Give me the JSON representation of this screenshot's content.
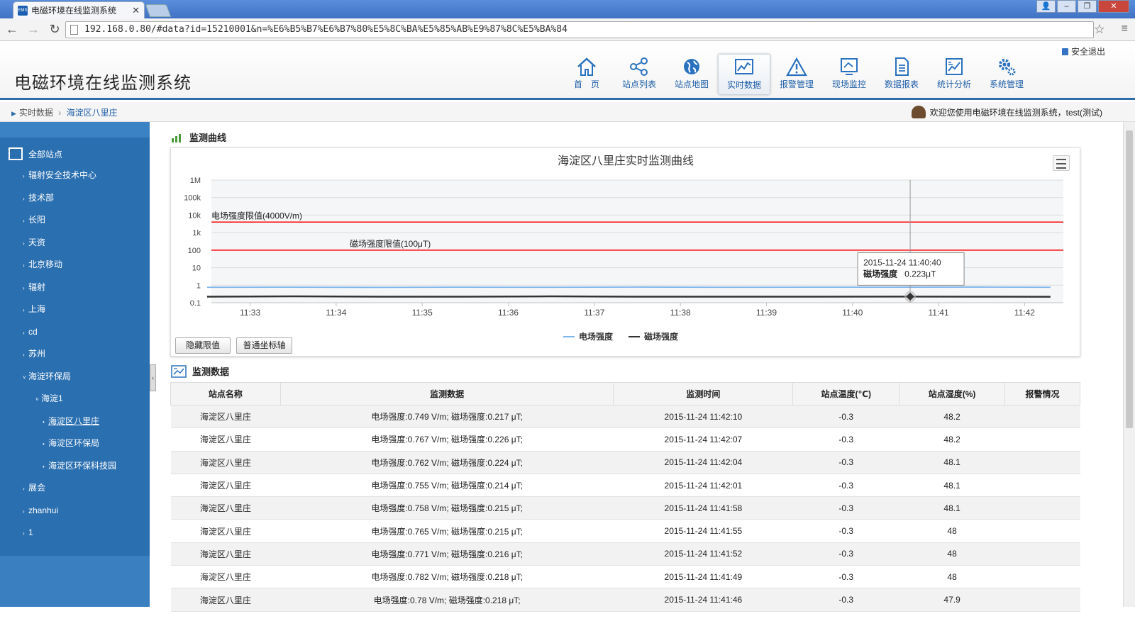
{
  "browser": {
    "tab_title": "电磁环境在线监测系统",
    "tab_favicon": "EMS",
    "url": "192.168.0.80/#data?id=15210001&n=%E6%B5%B7%E6%B7%80%E5%8C%BA%E5%85%AB%E9%87%8C%E5%BA%84"
  },
  "header": {
    "logo": "电磁环境在线监测系统",
    "logout": "安全退出",
    "nav": [
      {
        "label": "首　页",
        "icon": "home-icon"
      },
      {
        "label": "站点列表",
        "icon": "share-icon"
      },
      {
        "label": "站点地图",
        "icon": "globe-icon"
      },
      {
        "label": "实时数据",
        "icon": "realtime-chart-icon"
      },
      {
        "label": "报警管理",
        "icon": "warning-icon"
      },
      {
        "label": "现场监控",
        "icon": "monitor-icon"
      },
      {
        "label": "数据报表",
        "icon": "report-icon"
      },
      {
        "label": "统计分析",
        "icon": "stats-icon"
      },
      {
        "label": "系统管理",
        "icon": "gears-icon"
      }
    ],
    "active_nav": "实时数据"
  },
  "breadcrumb": {
    "parent": "实时数据",
    "current": "海淀区八里庄"
  },
  "welcome": "欢迎您使用电磁环境在线监测系统，test(测试)",
  "sidebar": {
    "root": "全部站点",
    "items": [
      {
        "label": "辐射安全技术中心",
        "level": 1,
        "arrow": "›"
      },
      {
        "label": "技术部",
        "level": 1,
        "arrow": "›"
      },
      {
        "label": "长阳",
        "level": 1,
        "arrow": "›"
      },
      {
        "label": "天资",
        "level": 1,
        "arrow": "›"
      },
      {
        "label": "北京移动",
        "level": 1,
        "arrow": "›"
      },
      {
        "label": "辐射",
        "level": 1,
        "arrow": "›"
      },
      {
        "label": "上海",
        "level": 1,
        "arrow": "›"
      },
      {
        "label": "cd",
        "level": 1,
        "arrow": "›"
      },
      {
        "label": "苏州",
        "level": 1,
        "arrow": "›"
      },
      {
        "label": "海淀环保局",
        "level": 1,
        "arrow": "˅"
      },
      {
        "label": "海淀1",
        "level": 2,
        "arrow": "˅"
      },
      {
        "label": "海淀区八里庄",
        "level": 3,
        "arrow": "•",
        "selected": true
      },
      {
        "label": "海淀区环保局",
        "level": 3,
        "arrow": "•"
      },
      {
        "label": "海淀区环保科技园",
        "level": 3,
        "arrow": "•"
      },
      {
        "label": "展会",
        "level": 1,
        "arrow": "›"
      },
      {
        "label": "zhanhui",
        "level": 1,
        "arrow": "›"
      },
      {
        "label": "1",
        "level": 1,
        "arrow": "›"
      }
    ]
  },
  "chart_section": {
    "title": "监测曲线",
    "hide_limit_button": "隐藏限值",
    "axis_button": "普通坐标轴"
  },
  "chart_data": {
    "type": "line",
    "title": "海淀区八里庄实时监测曲线",
    "y_scale": "log",
    "ylim": [
      0.1,
      1000000
    ],
    "y_ticks": [
      0.1,
      1,
      10,
      100,
      1000,
      10000,
      100000,
      1000000
    ],
    "y_tick_labels": [
      "0.1",
      "1",
      "10",
      "100",
      "1k",
      "10k",
      "100k",
      "1M"
    ],
    "x_tick_labels": [
      "11:33",
      "11:34",
      "11:35",
      "11:36",
      "11:37",
      "11:38",
      "11:39",
      "11:40",
      "11:41",
      "11:42"
    ],
    "x_range_minutes": [
      32.55,
      42.45
    ],
    "grid": true,
    "legend_position": "bottom",
    "series": [
      {
        "name": "电场强度",
        "color": "#7cb5ec",
        "x_minutes": [
          32.5,
          33.5,
          34.5,
          35.5,
          36.5,
          37.5,
          38.5,
          39.5,
          40.5,
          41.5,
          42.3
        ],
        "values": [
          0.76,
          0.77,
          0.75,
          0.77,
          0.76,
          0.78,
          0.76,
          0.77,
          0.77,
          0.78,
          0.76
        ]
      },
      {
        "name": "磁场强度",
        "color": "#333333",
        "x_minutes": [
          32.5,
          33.5,
          34.5,
          35.5,
          36.5,
          37.5,
          38.5,
          39.5,
          40.5,
          41.5,
          42.3
        ],
        "values": [
          0.22,
          0.23,
          0.22,
          0.22,
          0.23,
          0.22,
          0.22,
          0.22,
          0.223,
          0.22,
          0.217
        ]
      }
    ],
    "limits": [
      {
        "label": "电场强度限值(4000V/m)",
        "value": 4000,
        "color": "#ff0000"
      },
      {
        "label": "磁场强度限值(100μT)",
        "value": 100,
        "color": "#ff0000"
      }
    ],
    "tooltip": {
      "time": "2015-11-24 11:40:40",
      "series": "磁场强度",
      "value_text": "0.223μT",
      "x_minute": 40.67,
      "value": 0.223
    }
  },
  "data_section": {
    "title": "监测数据",
    "columns": [
      "站点名称",
      "监测数据",
      "监测时间",
      "站点温度(℃)",
      "站点湿度(%)",
      "报警情况"
    ],
    "rows": [
      [
        "海淀区八里庄",
        "电场强度:0.749 V/m; 磁场强度:0.217 μT;",
        "2015-11-24 11:42:10",
        "-0.3",
        "48.2",
        ""
      ],
      [
        "海淀区八里庄",
        "电场强度:0.767 V/m; 磁场强度:0.226 μT;",
        "2015-11-24 11:42:07",
        "-0.3",
        "48.2",
        ""
      ],
      [
        "海淀区八里庄",
        "电场强度:0.762 V/m; 磁场强度:0.224 μT;",
        "2015-11-24 11:42:04",
        "-0.3",
        "48.1",
        ""
      ],
      [
        "海淀区八里庄",
        "电场强度:0.755 V/m; 磁场强度:0.214 μT;",
        "2015-11-24 11:42:01",
        "-0.3",
        "48.1",
        ""
      ],
      [
        "海淀区八里庄",
        "电场强度:0.758 V/m; 磁场强度:0.215 μT;",
        "2015-11-24 11:41:58",
        "-0.3",
        "48.1",
        ""
      ],
      [
        "海淀区八里庄",
        "电场强度:0.765 V/m; 磁场强度:0.215 μT;",
        "2015-11-24 11:41:55",
        "-0.3",
        "48",
        ""
      ],
      [
        "海淀区八里庄",
        "电场强度:0.771 V/m; 磁场强度:0.216 μT;",
        "2015-11-24 11:41:52",
        "-0.3",
        "48",
        ""
      ],
      [
        "海淀区八里庄",
        "电场强度:0.782 V/m; 磁场强度:0.218 μT;",
        "2015-11-24 11:41:49",
        "-0.3",
        "48",
        ""
      ],
      [
        "海淀区八里庄",
        "电场强度:0.78 V/m; 磁场强度:0.218 μT;",
        "2015-11-24 11:41:46",
        "-0.3",
        "47.9",
        ""
      ]
    ]
  }
}
